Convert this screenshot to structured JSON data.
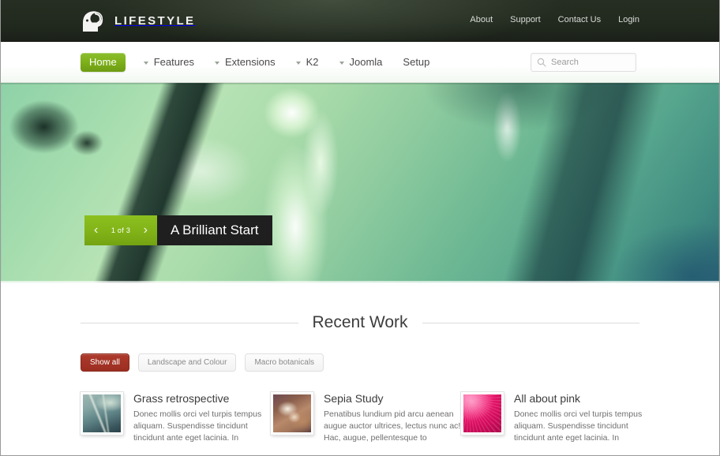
{
  "header": {
    "brand_name": "LIFESTYLE",
    "logo_icon": "head-profile-icon",
    "top_links": [
      {
        "label": "About"
      },
      {
        "label": "Support"
      },
      {
        "label": "Contact Us"
      },
      {
        "label": "Login"
      }
    ]
  },
  "nav": {
    "items": [
      {
        "label": "Home",
        "active": true,
        "has_caret": false
      },
      {
        "label": "Features",
        "active": false,
        "has_caret": true
      },
      {
        "label": "Extensions",
        "active": false,
        "has_caret": true
      },
      {
        "label": "K2",
        "active": false,
        "has_caret": true
      },
      {
        "label": "Joomla",
        "active": false,
        "has_caret": true
      },
      {
        "label": "Setup",
        "active": false,
        "has_caret": false
      }
    ],
    "search": {
      "placeholder": "Search",
      "value": "",
      "icon": "search-icon"
    }
  },
  "hero": {
    "slide_title": "A Brilliant Start",
    "counter": "1 of 3",
    "prev_icon": "chevron-left-icon",
    "next_icon": "chevron-right-icon"
  },
  "recent_work": {
    "heading": "Recent Work",
    "filters": [
      {
        "label": "Show all",
        "active": true
      },
      {
        "label": "Landscape and Colour",
        "active": false
      },
      {
        "label": "Macro botanicals",
        "active": false
      }
    ],
    "items": [
      {
        "title": "Grass retrospective",
        "text": "Donec mollis orci vel turpis tempus aliquam. Suspendisse tincidunt tincidunt ante eget lacinia. In",
        "thumb": "grass-thumbnail"
      },
      {
        "title": "Sepia Study",
        "text": "Penatibus lundium pid arcu aenean augue auctor ultrices, lectus nunc ac! Hac, augue, pellentesque to",
        "thumb": "sepia-thumbnail"
      },
      {
        "title": "All about pink",
        "text": "Donec mollis orci vel turpis tempus aliquam. Suspendisse tincidunt tincidunt ante eget lacinia. In",
        "thumb": "pink-flower-thumbnail"
      }
    ]
  },
  "colors": {
    "header_bg": "#232a1f",
    "nav_active": "#7db019",
    "slider_green": "#82b418",
    "slider_dark": "#1f1f1f",
    "filter_active": "#9b2e21",
    "text_dark": "#3c3c3c",
    "text_muted": "#6f6f6f"
  }
}
